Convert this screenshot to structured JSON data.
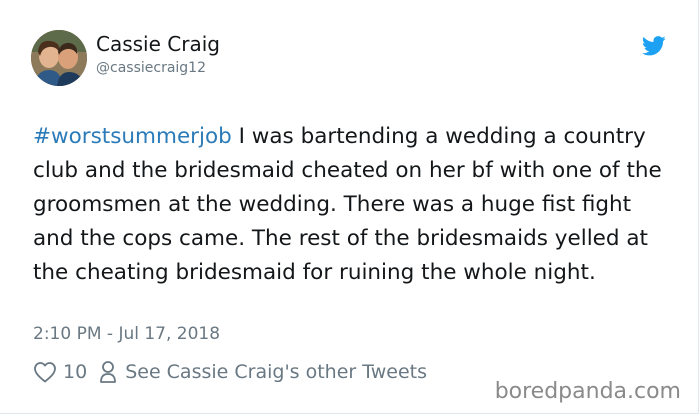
{
  "author": {
    "name": "Cassie Craig",
    "handle": "@cassiecraig12"
  },
  "tweet": {
    "hashtag": "#worstsummerjob",
    "text": " I was bartending a wedding a country club and the bridesmaid cheated on her bf with one of the groomsmen at the wedding. There was a huge fist fight and the cops came. The rest of the bridesmaids yelled at the cheating bridesmaid for ruining the whole night."
  },
  "timestamp": "2:10 PM - Jul 17, 2018",
  "actions": {
    "likes": "10",
    "other_tweets": "See Cassie Craig's other Tweets"
  },
  "watermark": "boredpanda.com",
  "icons": {
    "brand": "twitter-bird-icon",
    "like": "heart-outline-icon",
    "profile": "person-outline-icon"
  },
  "colors": {
    "hashtag": "#2b7bb9",
    "twitter_blue": "#1da1f2",
    "secondary_text": "#697882"
  }
}
